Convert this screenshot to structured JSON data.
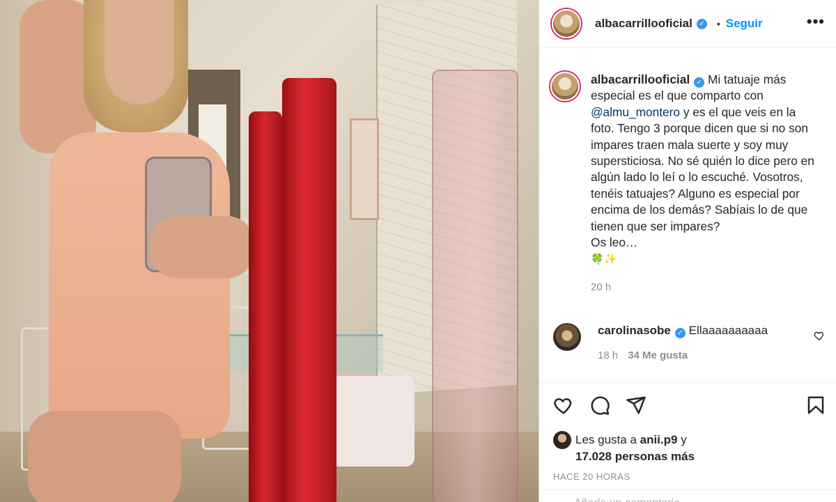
{
  "post": {
    "author": "albacarrillooficial",
    "follow_label": "Seguir",
    "more_label": "•••",
    "dot": "•"
  },
  "caption": {
    "author": "albacarrillooficial",
    "text_before": "Mi tatuaje más especial es el que comparto con ",
    "mention": "@almu_montero",
    "text_after": " y es el que veis en la foto. Tengo 3 porque dicen que si no son impares traen mala suerte y soy muy supersticiosa. No sé quién lo dice pero en algún lado lo leí o lo escuché. Vosotros, tenéis tatuajes? Alguno es especial por encima de los demás? Sabíais lo de que tienen que ser impares?",
    "line_final": "Os leo…",
    "emojis": "🍀✨",
    "time": "20 h"
  },
  "comment": {
    "author": "carolinasobe",
    "text": "Ellaaaaaaaaaa",
    "time": "18 h",
    "likes": "34 Me gusta"
  },
  "likes": {
    "prefix": "Les gusta a ",
    "user": "anii.p9",
    "mid": " y",
    "count": "17.028 personas más"
  },
  "posted_ago": "HACE 20 HORAS",
  "add_comment_placeholder": "Añade un comentario...",
  "colors": {
    "accent": "#0095f6",
    "verified": "#3897f0",
    "muted": "#8e8e8e",
    "text": "#262626"
  },
  "icons": [
    "verified-badge-icon",
    "heart-icon",
    "comment-icon",
    "share-icon",
    "bookmark-icon",
    "more-icon"
  ]
}
